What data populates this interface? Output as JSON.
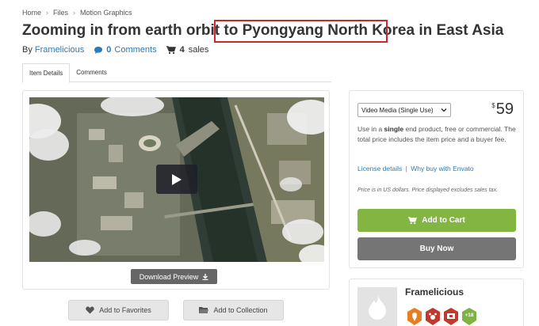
{
  "breadcrumb": [
    "Home",
    "Files",
    "Motion Graphics"
  ],
  "title": "Zooming in from earth orbit to Pyongyang North Korea in East Asia",
  "meta": {
    "by_label": "By",
    "author": "Framelicious",
    "comments_count": "0",
    "comments_label": "Comments",
    "sales_count": "4",
    "sales_label": "sales"
  },
  "tabs": [
    {
      "label": "Item Details",
      "active": true
    },
    {
      "label": "Comments",
      "active": false
    }
  ],
  "preview": {
    "download_label": "Download Preview"
  },
  "actions": {
    "favorites_label": "Add to Favorites",
    "collection_label": "Add to Collection"
  },
  "purchase": {
    "license_selected": "Video Media (Single Use)",
    "currency_symbol": "$",
    "price": "59",
    "desc_part1": "Use in a ",
    "desc_bold": "single",
    "desc_part2": " end product, free or commercial. The total price includes the item price and a buyer fee.",
    "license_details_label": "License details",
    "separator": "|",
    "why_envato_label": "Why buy with Envato",
    "note": "Price is in US dollars. Price displayed excludes sales tax.",
    "cart_label": "Add to Cart",
    "buy_label": "Buy Now"
  },
  "author_panel": {
    "name": "Framelicious",
    "badges": [
      {
        "icon": "location-badge",
        "color": "#e67e22",
        "text": ""
      },
      {
        "icon": "paw-badge",
        "color": "#c0392b",
        "text": ""
      },
      {
        "icon": "community-badge",
        "color": "#c0392b",
        "text": ""
      },
      {
        "icon": "years-badge",
        "color": "#7cb342",
        "text": "+18"
      }
    ]
  },
  "colors": {
    "accent_link": "#2b7bb9",
    "cart_green": "#82b541",
    "buy_gray": "#757575",
    "highlight_red": "#c8292e"
  }
}
